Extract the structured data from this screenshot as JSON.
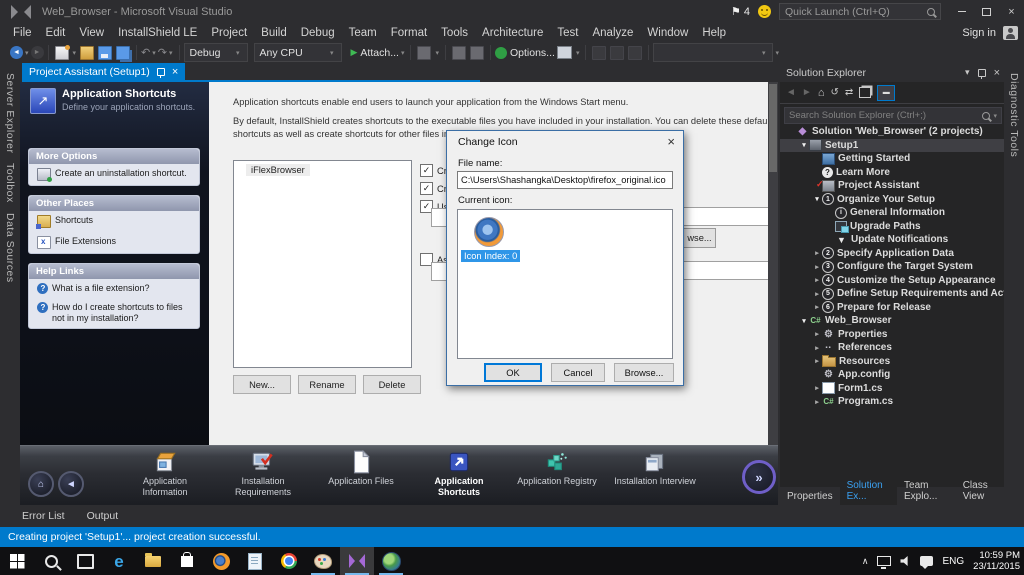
{
  "titlebar": {
    "title": "Web_Browser - Microsoft Visual Studio",
    "notification_count": "4",
    "quick_launch_placeholder": "Quick Launch (Ctrl+Q)"
  },
  "menubar": {
    "items": [
      "File",
      "Edit",
      "View",
      "InstallShield LE",
      "Project",
      "Build",
      "Debug",
      "Team",
      "Format",
      "Tools",
      "Architecture",
      "Test",
      "Analyze",
      "Window",
      "Help"
    ],
    "sign_in": "Sign in"
  },
  "toolbar": {
    "configuration": "Debug",
    "platform": "Any CPU",
    "attach_label": "Attach...",
    "options_label": "Options..."
  },
  "left_tabs": [
    "Server Explorer",
    "Toolbox",
    "Data Sources"
  ],
  "right_tabs": [
    "Diagnostic Tools"
  ],
  "document": {
    "tab_title": "Project Assistant (Setup1)",
    "header_title": "Application Shortcuts",
    "header_subtitle": "Define your application shortcuts.",
    "panels": [
      {
        "title": "More Options",
        "items": [
          {
            "icon": "uninstall-shortcut-icon",
            "label": "Create an uninstallation shortcut."
          }
        ]
      },
      {
        "title": "Other Places",
        "items": [
          {
            "icon": "shortcuts-folder-icon",
            "label": "Shortcuts"
          },
          {
            "icon": "file-extensions-icon",
            "label": "File Extensions"
          }
        ]
      },
      {
        "title": "Help Links",
        "items": [
          {
            "icon": "help-icon",
            "label": "What is a file extension?"
          },
          {
            "icon": "help-icon",
            "label": "How do I create shortcuts to files not in my installation?"
          }
        ]
      }
    ],
    "intro1": "Application shortcuts enable end users to launch your application from the Windows Start menu.",
    "intro2": "By default, InstallShield creates shortcuts to the executable files you have included in your installation. You can delete these default shortcuts as well as create shortcuts for other files in your in",
    "shortcut_item": "iFlexBrowser",
    "buttons": [
      "New...",
      "Rename",
      "Delete"
    ],
    "checkbox_fragments": [
      {
        "label": "Crea",
        "checked": true
      },
      {
        "label": "Crea",
        "checked": true
      },
      {
        "label": "Use",
        "checked": true
      },
      {
        "label": "Asso",
        "checked": false
      }
    ],
    "browse_button_fragment": "wse..."
  },
  "dialog": {
    "title": "Change Icon",
    "file_name_label": "File name:",
    "file_name_value": "C:\\Users\\Shashangka\\Desktop\\firefox_original.ico",
    "current_icon_label": "Current icon:",
    "icon_index_label": "Icon Index: 0",
    "ok": "OK",
    "cancel": "Cancel",
    "browse": "Browse..."
  },
  "bottom_nav": {
    "items": [
      {
        "icon": "application-information-icon",
        "label": "Application Information"
      },
      {
        "icon": "installation-requirements-icon",
        "label": "Installation Requirements"
      },
      {
        "icon": "application-files-icon",
        "label": "Application Files"
      },
      {
        "icon": "application-shortcuts-icon",
        "label": "Application Shortcuts"
      },
      {
        "icon": "application-registry-icon",
        "label": "Application Registry"
      },
      {
        "icon": "installation-interview-icon",
        "label": "Installation Interview"
      }
    ],
    "active_index": 3
  },
  "output_tabs": [
    "Error List",
    "Output"
  ],
  "statusbar": {
    "text": "Creating project 'Setup1'... project creation successful.",
    "color": "#007acc"
  },
  "solution_explorer": {
    "title": "Solution Explorer",
    "search_placeholder": "Search Solution Explorer (Ctrl+;)",
    "tree": [
      {
        "label": "Solution 'Web_Browser' (2 projects)",
        "level": 0,
        "arrow": "",
        "icon": "solution"
      },
      {
        "label": "Setup1",
        "level": 1,
        "arrow": "exp",
        "icon": "setup-project",
        "selected": true
      },
      {
        "label": "Getting Started",
        "level": 2,
        "arrow": "",
        "icon": "getting-started"
      },
      {
        "label": "Learn More",
        "level": 2,
        "arrow": "",
        "icon": "help"
      },
      {
        "label": "Project Assistant",
        "level": 2,
        "arrow": "",
        "icon": "project-assistant"
      },
      {
        "label": "Organize Your Setup",
        "level": 2,
        "arrow": "exp",
        "icon": "step-1"
      },
      {
        "label": "General Information",
        "level": 3,
        "arrow": "",
        "icon": "info"
      },
      {
        "label": "Upgrade Paths",
        "level": 3,
        "arrow": "",
        "icon": "upgrade-paths"
      },
      {
        "label": "Update Notifications",
        "level": 3,
        "arrow": "",
        "icon": "update-notifications"
      },
      {
        "label": "Specify Application Data",
        "level": 2,
        "arrow": "col",
        "icon": "step-2"
      },
      {
        "label": "Configure the Target System",
        "level": 2,
        "arrow": "col",
        "icon": "step-3"
      },
      {
        "label": "Customize the Setup Appearance",
        "level": 2,
        "arrow": "col",
        "icon": "step-4"
      },
      {
        "label": "Define Setup Requirements and Actions",
        "level": 2,
        "arrow": "col",
        "icon": "step-5"
      },
      {
        "label": "Prepare for Release",
        "level": 2,
        "arrow": "col",
        "icon": "step-6"
      },
      {
        "label": "Web_Browser",
        "level": 1,
        "arrow": "exp",
        "icon": "csharp-project"
      },
      {
        "label": "Properties",
        "level": 2,
        "arrow": "col",
        "icon": "wrench"
      },
      {
        "label": "References",
        "level": 2,
        "arrow": "col",
        "icon": "references"
      },
      {
        "label": "Resources",
        "level": 2,
        "arrow": "col",
        "icon": "folder"
      },
      {
        "label": "App.config",
        "level": 2,
        "arrow": "",
        "icon": "app-config"
      },
      {
        "label": "Form1.cs",
        "level": 2,
        "arrow": "col",
        "icon": "winform"
      },
      {
        "label": "Program.cs",
        "level": 2,
        "arrow": "col",
        "icon": "csharp-file"
      }
    ],
    "tabs": [
      "Properties",
      "Solution Ex...",
      "Team Explo...",
      "Class View"
    ],
    "active_tab_index": 1
  },
  "taskbar": {
    "icons": [
      {
        "name": "start"
      },
      {
        "name": "search"
      },
      {
        "name": "task-view"
      },
      {
        "name": "edge"
      },
      {
        "name": "file-explorer"
      },
      {
        "name": "store"
      },
      {
        "name": "firefox"
      },
      {
        "name": "notepad"
      },
      {
        "name": "chrome"
      },
      {
        "name": "paint",
        "underline": true
      },
      {
        "name": "visual-studio",
        "underline": true,
        "active": true
      },
      {
        "name": "web-browser-app",
        "underline": true
      }
    ],
    "language": "ENG",
    "time": "10:59 PM",
    "date": "23/11/2015"
  }
}
